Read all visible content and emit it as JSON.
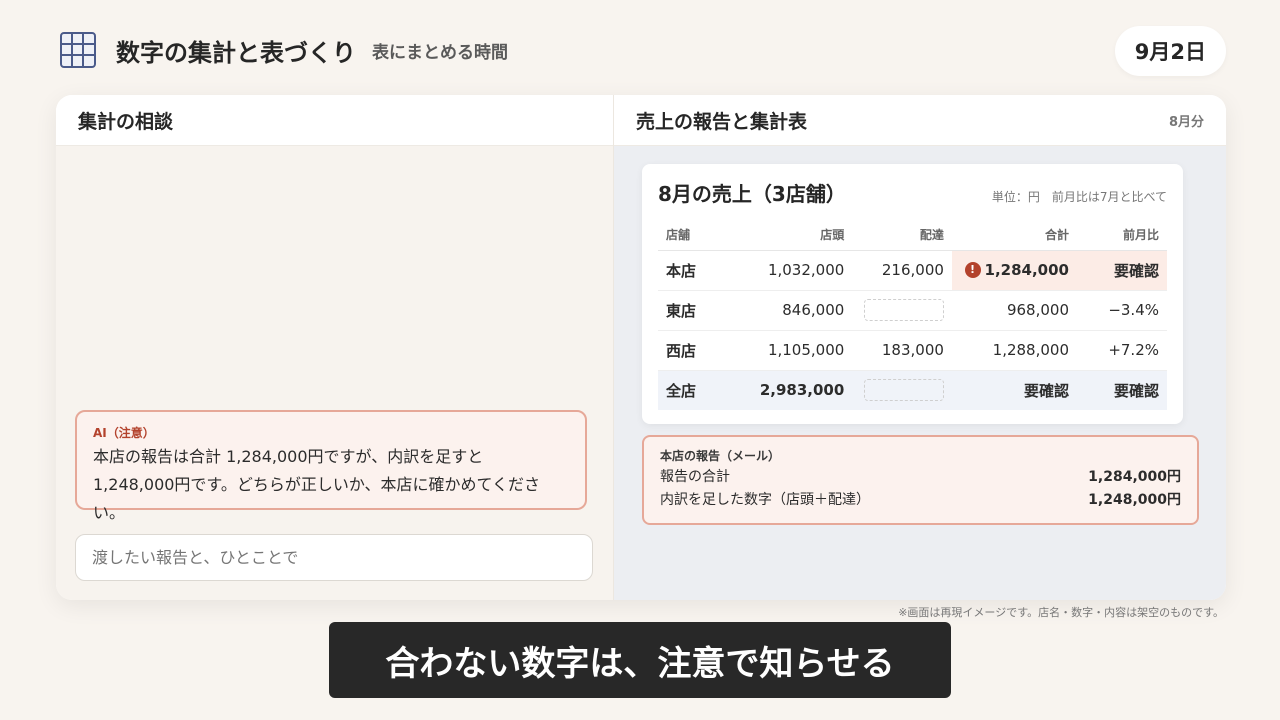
{
  "header": {
    "icon": "grid-table-icon",
    "title": "数字の集計と表づくり",
    "subtitle": "表にまとめる時間",
    "date": "9月2日"
  },
  "left_pane": {
    "title": "集計の相談",
    "ai_alert": {
      "label": "AI（注意）",
      "text": "本店の報告は合計 1,284,000円ですが、内訳を足すと 1,248,000円です。どちらが正しいか、本店に確かめてください。"
    },
    "input": {
      "placeholder": "渡したい報告と、ひとことで",
      "value": ""
    }
  },
  "right_pane": {
    "title": "売上の報告と集計表",
    "period": "8月分",
    "sales_card": {
      "title": "8月の売上（3店舗）",
      "note": "単位：円　前月比は7月と比べて",
      "columns": [
        "店舗",
        "店頭",
        "配達",
        "合計",
        "前月比"
      ],
      "rows": [
        {
          "store": "本店",
          "storefront": "1,032,000",
          "delivery": "216,000",
          "total": "1,284,000",
          "mom": "要確認"
        },
        {
          "store": "東店",
          "storefront": "846,000",
          "delivery": "",
          "total": "968,000",
          "mom": "−3.4%"
        },
        {
          "store": "西店",
          "storefront": "1,105,000",
          "delivery": "183,000",
          "total": "1,288,000",
          "mom": "+7.2%"
        }
      ],
      "total_row": {
        "store": "全店",
        "storefront": "2,983,000",
        "delivery": "",
        "total": "要確認",
        "mom": "要確認"
      }
    },
    "mail": {
      "label": "本店の報告（メール）",
      "rows": [
        {
          "label": "報告の合計",
          "value": "1,284,000円"
        },
        {
          "label": "内訳を足した数字（店頭＋配達）",
          "value": "1,248,000円"
        }
      ]
    }
  },
  "disclaimer": "※画面は再現イメージです。店名・数字・内容は架空のものです。",
  "caption": "合わない数字は、注意で知らせる",
  "colors": {
    "accent_warn": "#b3422c",
    "warn_bg": "#fcf2ee",
    "caption_bg": "#282828"
  }
}
